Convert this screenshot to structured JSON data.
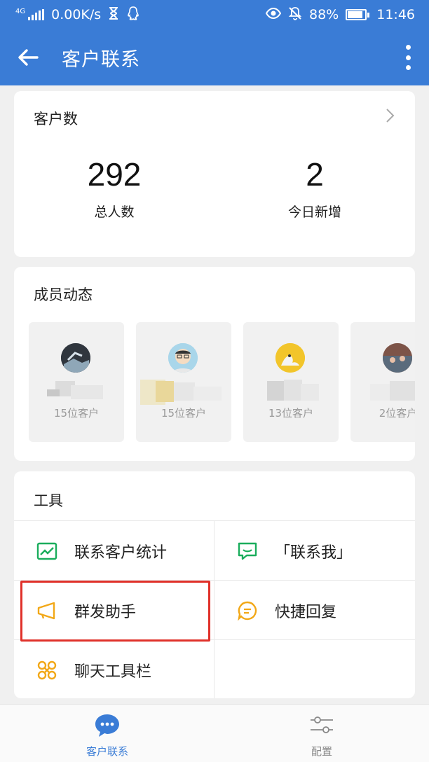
{
  "status_bar": {
    "network_type": "4G",
    "speed": "0.00K/s",
    "battery": "88%",
    "battery_level": 0.88,
    "time": "11:46"
  },
  "app_bar": {
    "title": "客户联系"
  },
  "customers": {
    "title": "客户数",
    "total_value": "292",
    "total_label": "总人数",
    "today_value": "2",
    "today_label": "今日新增"
  },
  "members": {
    "title": "成员动态",
    "items": [
      {
        "count": "15位客户"
      },
      {
        "count": "15位客户"
      },
      {
        "count": "13位客户"
      },
      {
        "count": "2位客户"
      }
    ]
  },
  "tools": {
    "title": "工具",
    "items": [
      {
        "label": "联系客户统计",
        "icon": "chart-icon"
      },
      {
        "label": "「联系我」",
        "icon": "message-icon"
      },
      {
        "label": "群发助手",
        "icon": "megaphone-icon"
      },
      {
        "label": "快捷回复",
        "icon": "quick-reply-icon"
      },
      {
        "label": "聊天工具栏",
        "icon": "toolbar-icon"
      }
    ]
  },
  "bottom_nav": {
    "items": [
      {
        "label": "客户联系",
        "icon": "chat-bubble-icon",
        "active": true
      },
      {
        "label": "配置",
        "icon": "sliders-icon",
        "active": false
      }
    ]
  },
  "colors": {
    "primary": "#3a7cd6",
    "tool_green": "#1aad5c",
    "tool_orange": "#f2a818",
    "highlight_red": "#e0312a",
    "nav_active": "#3a7cd6",
    "nav_inactive": "#888888"
  }
}
